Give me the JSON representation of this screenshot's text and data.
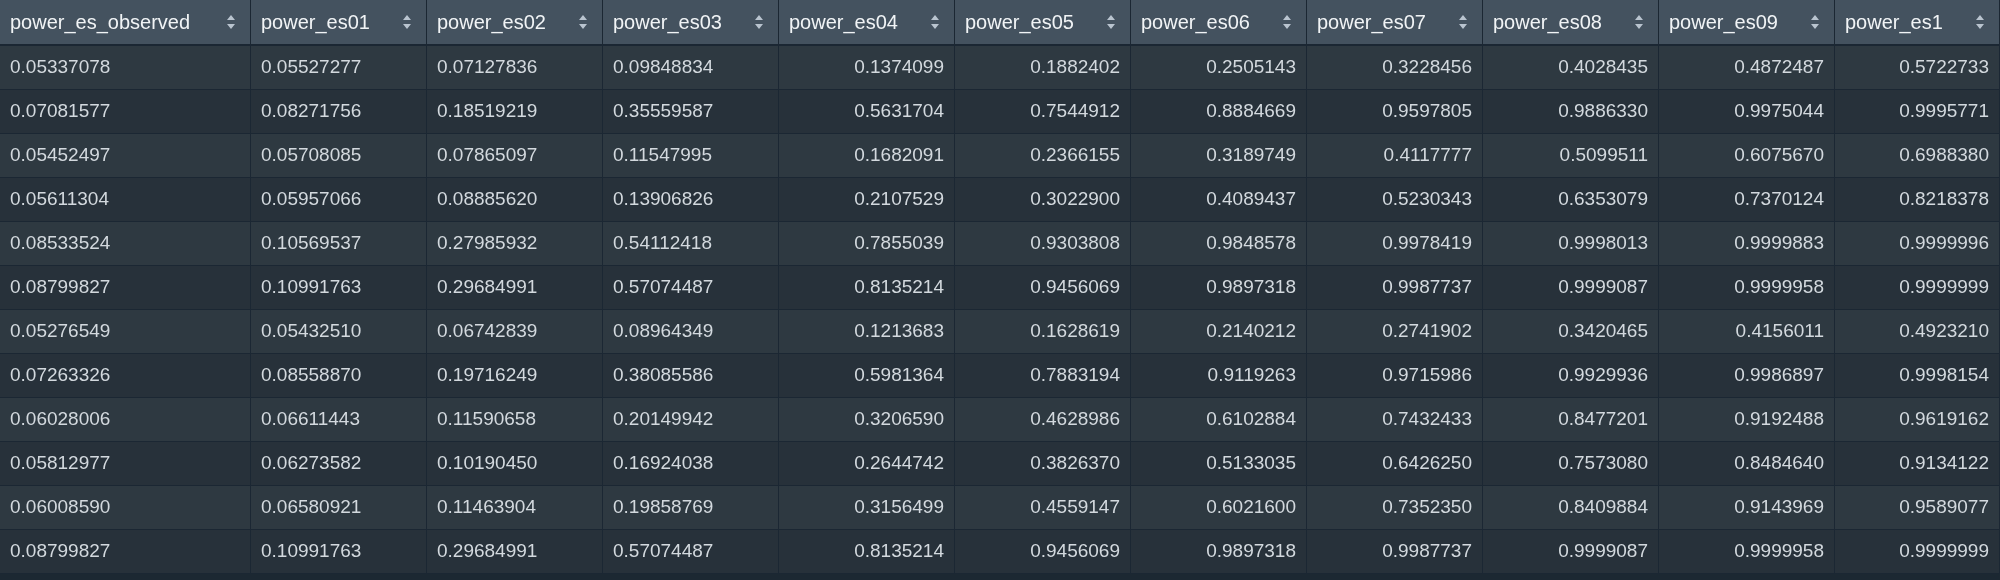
{
  "table": {
    "columns": [
      {
        "label": "power_es_observed"
      },
      {
        "label": "power_es01"
      },
      {
        "label": "power_es02"
      },
      {
        "label": "power_es03"
      },
      {
        "label": "power_es04"
      },
      {
        "label": "power_es05"
      },
      {
        "label": "power_es06"
      },
      {
        "label": "power_es07"
      },
      {
        "label": "power_es08"
      },
      {
        "label": "power_es09"
      },
      {
        "label": "power_es1"
      }
    ],
    "rows": [
      [
        "0.05337078",
        "0.05527277",
        "0.07127836",
        "0.09848834",
        "0.1374099",
        "0.1882402",
        "0.2505143",
        "0.3228456",
        "0.4028435",
        "0.4872487",
        "0.5722733"
      ],
      [
        "0.07081577",
        "0.08271756",
        "0.18519219",
        "0.35559587",
        "0.5631704",
        "0.7544912",
        "0.8884669",
        "0.9597805",
        "0.9886330",
        "0.9975044",
        "0.9995771"
      ],
      [
        "0.05452497",
        "0.05708085",
        "0.07865097",
        "0.11547995",
        "0.1682091",
        "0.2366155",
        "0.3189749",
        "0.4117777",
        "0.5099511",
        "0.6075670",
        "0.6988380"
      ],
      [
        "0.05611304",
        "0.05957066",
        "0.08885620",
        "0.13906826",
        "0.2107529",
        "0.3022900",
        "0.4089437",
        "0.5230343",
        "0.6353079",
        "0.7370124",
        "0.8218378"
      ],
      [
        "0.08533524",
        "0.10569537",
        "0.27985932",
        "0.54112418",
        "0.7855039",
        "0.9303808",
        "0.9848578",
        "0.9978419",
        "0.9998013",
        "0.9999883",
        "0.9999996"
      ],
      [
        "0.08799827",
        "0.10991763",
        "0.29684991",
        "0.57074487",
        "0.8135214",
        "0.9456069",
        "0.9897318",
        "0.9987737",
        "0.9999087",
        "0.9999958",
        "0.9999999"
      ],
      [
        "0.05276549",
        "0.05432510",
        "0.06742839",
        "0.08964349",
        "0.1213683",
        "0.1628619",
        "0.2140212",
        "0.2741902",
        "0.3420465",
        "0.4156011",
        "0.4923210"
      ],
      [
        "0.07263326",
        "0.08558870",
        "0.19716249",
        "0.38085586",
        "0.5981364",
        "0.7883194",
        "0.9119263",
        "0.9715986",
        "0.9929936",
        "0.9986897",
        "0.9998154"
      ],
      [
        "0.06028006",
        "0.06611443",
        "0.11590658",
        "0.20149942",
        "0.3206590",
        "0.4628986",
        "0.6102884",
        "0.7432433",
        "0.8477201",
        "0.9192488",
        "0.9619162"
      ],
      [
        "0.05812977",
        "0.06273582",
        "0.10190450",
        "0.16924038",
        "0.2644742",
        "0.3826370",
        "0.5133035",
        "0.6426250",
        "0.7573080",
        "0.8484640",
        "0.9134122"
      ],
      [
        "0.06008590",
        "0.06580921",
        "0.11463904",
        "0.19858769",
        "0.3156499",
        "0.4559147",
        "0.6021600",
        "0.7352350",
        "0.8409884",
        "0.9143969",
        "0.9589077"
      ],
      [
        "0.08799827",
        "0.10991763",
        "0.29684991",
        "0.57074487",
        "0.8135214",
        "0.9456069",
        "0.9897318",
        "0.9987737",
        "0.9999087",
        "0.9999958",
        "0.9999999"
      ]
    ]
  }
}
